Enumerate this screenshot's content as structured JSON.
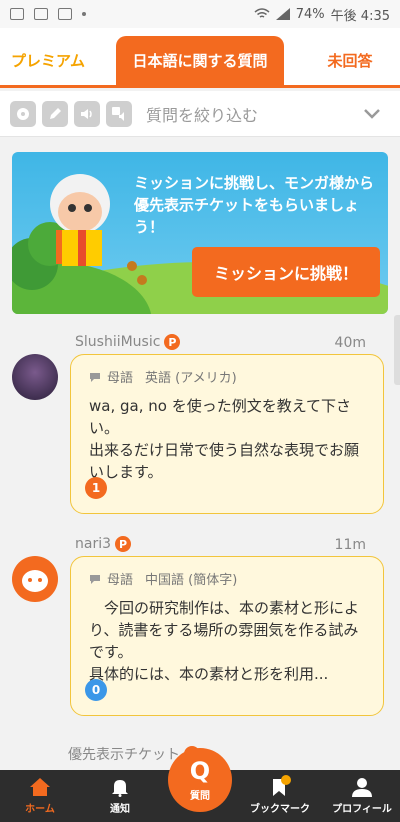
{
  "status_bar": {
    "battery": "74%",
    "time": "午後 4:35"
  },
  "tabs": [
    {
      "label": "プレミアム"
    },
    {
      "label": "日本語に関する質問"
    },
    {
      "label": "未回答"
    }
  ],
  "filter": {
    "label": "質問を絞り込む"
  },
  "banner": {
    "text": "ミッションに挑戦し、モンガ様から優先表示チケットをもらいましょう！",
    "button": "ミッションに挑戦！"
  },
  "posts": [
    {
      "user": "SlushiiMusic",
      "badge": "P",
      "time": "40m",
      "native_label": "母語",
      "native_lang": "英語 (アメリカ)",
      "text": "wa, ga, no を使った例文を教えて下さい。\n出来るだけ日常で使う自然な表現でお願いします。",
      "count": "1",
      "count_color": "#f36a1f"
    },
    {
      "user": "nari3",
      "badge": "P",
      "time": "11m",
      "native_label": "母語",
      "native_lang": "中国語 (簡体字)",
      "text": "今回の研究制作は、本の素材と形により、読書をする場所の雰囲気を作る試みです。\n具体的には、本の素材と形を利用...",
      "count": "0",
      "count_color": "#3b97e8"
    }
  ],
  "next_post": {
    "label": "優先表示チケット",
    "badge": "P"
  },
  "bottom_nav": {
    "home": "ホーム",
    "notifications": "通知",
    "ask_icon": "Q",
    "ask": "質問",
    "bookmark": "ブックマーク",
    "bookmark_badge": "P",
    "profile": "プロフィール"
  },
  "colors": {
    "accent": "#f36a1f",
    "premium": "#f5a300",
    "bubble": "#fff8dd",
    "nav": "#2d2d2d"
  }
}
